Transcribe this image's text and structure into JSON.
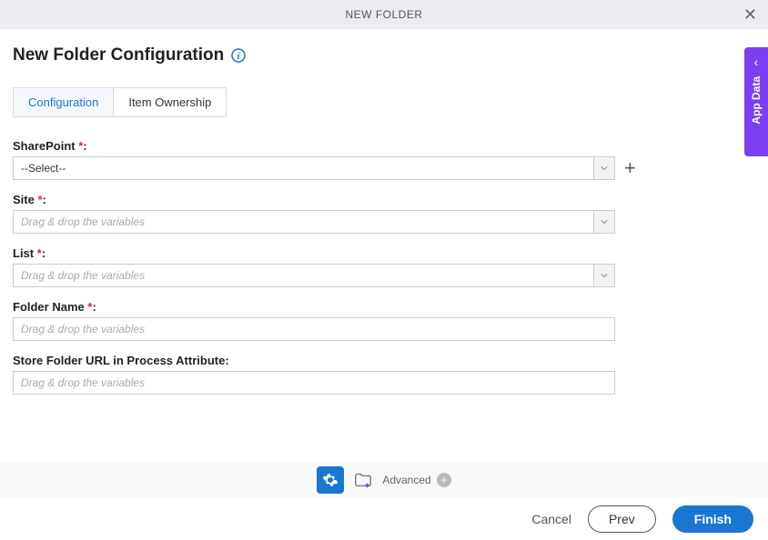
{
  "header": {
    "title": "NEW FOLDER"
  },
  "page": {
    "title": "New Folder Configuration"
  },
  "tabs": [
    {
      "label": "Configuration"
    },
    {
      "label": "Item Ownership"
    }
  ],
  "fields": {
    "sharepoint": {
      "label": "SharePoint",
      "value": "--Select--"
    },
    "site": {
      "label": "Site",
      "placeholder": "Drag & drop the variables"
    },
    "list": {
      "label": "List",
      "placeholder": "Drag & drop the variables"
    },
    "folderName": {
      "label": "Folder Name",
      "placeholder": "Drag & drop the variables"
    },
    "storeUrl": {
      "label": "Store Folder URL in Process Attribute:",
      "placeholder": "Drag & drop the variables"
    }
  },
  "bottom": {
    "advanced": "Advanced"
  },
  "footer": {
    "cancel": "Cancel",
    "prev": "Prev",
    "finish": "Finish"
  },
  "sidebar": {
    "label": "App Data"
  }
}
